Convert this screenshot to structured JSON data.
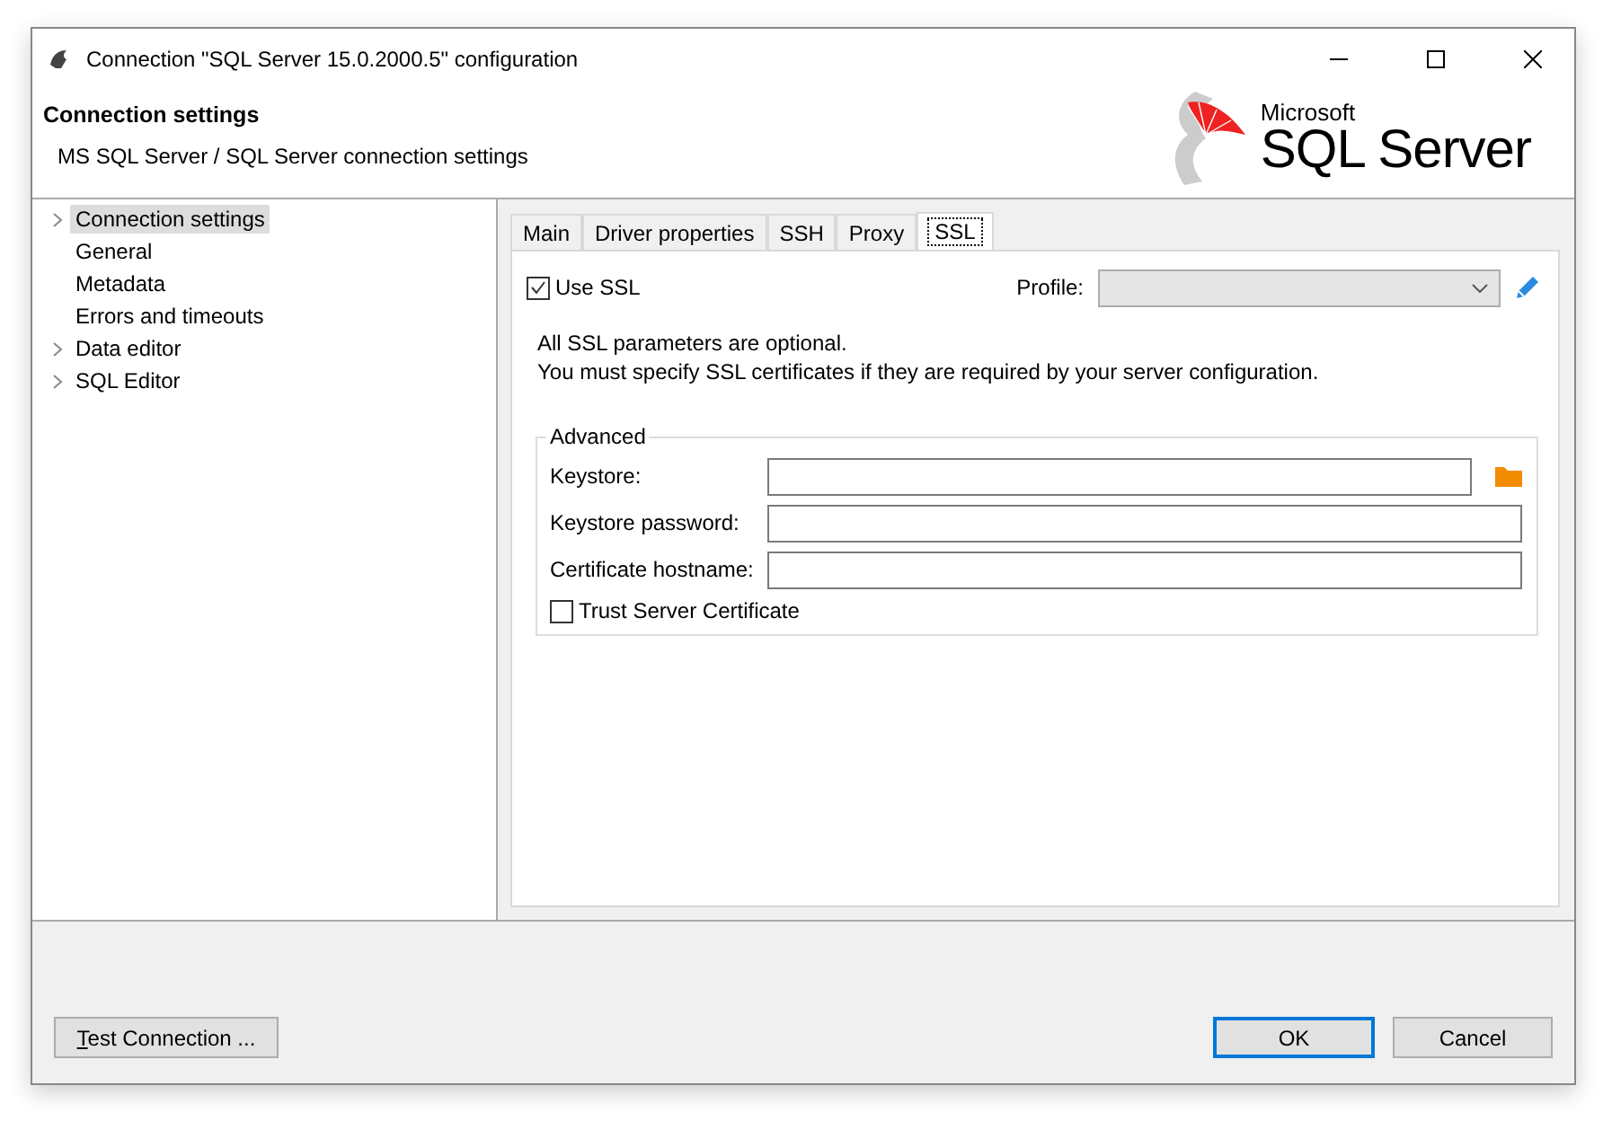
{
  "window": {
    "title": "Connection \"SQL Server 15.0.2000.5\" configuration"
  },
  "header": {
    "title": "Connection settings",
    "subtitle": "MS SQL Server / SQL Server connection settings",
    "logo": {
      "brand": "Microsoft",
      "product": "SQL Server"
    }
  },
  "sidebar": {
    "items": [
      {
        "label": "Connection settings",
        "kind": "group",
        "expanded": false,
        "selected": true
      },
      {
        "label": "General",
        "kind": "leaf",
        "selected": false
      },
      {
        "label": "Metadata",
        "kind": "leaf",
        "selected": false
      },
      {
        "label": "Errors and timeouts",
        "kind": "leaf",
        "selected": false
      },
      {
        "label": "Data editor",
        "kind": "group",
        "expanded": false,
        "selected": false
      },
      {
        "label": "SQL Editor",
        "kind": "group",
        "expanded": false,
        "selected": false
      }
    ]
  },
  "tabs": [
    {
      "label": "Main",
      "selected": false
    },
    {
      "label": "Driver properties",
      "selected": false
    },
    {
      "label": "SSH",
      "selected": false
    },
    {
      "label": "Proxy",
      "selected": false
    },
    {
      "label": "SSL",
      "selected": true
    }
  ],
  "ssl": {
    "use_ssl": {
      "label": "Use SSL",
      "checked": true
    },
    "profile": {
      "label": "Profile:"
    },
    "notes": [
      "All SSL parameters are optional.",
      "You must specify SSL certificates if they are required by your server configuration."
    ],
    "advanced": {
      "title": "Advanced",
      "fields": [
        {
          "label": "Keystore:",
          "kind": "file"
        },
        {
          "label": "Keystore password:",
          "kind": "text"
        },
        {
          "label": "Certificate hostname:",
          "kind": "text"
        }
      ],
      "trust": {
        "label": "Trust Server Certificate",
        "checked": false
      }
    }
  },
  "buttons": {
    "test": "Test Connection ...",
    "ok": "OK",
    "cancel": "Cancel"
  }
}
